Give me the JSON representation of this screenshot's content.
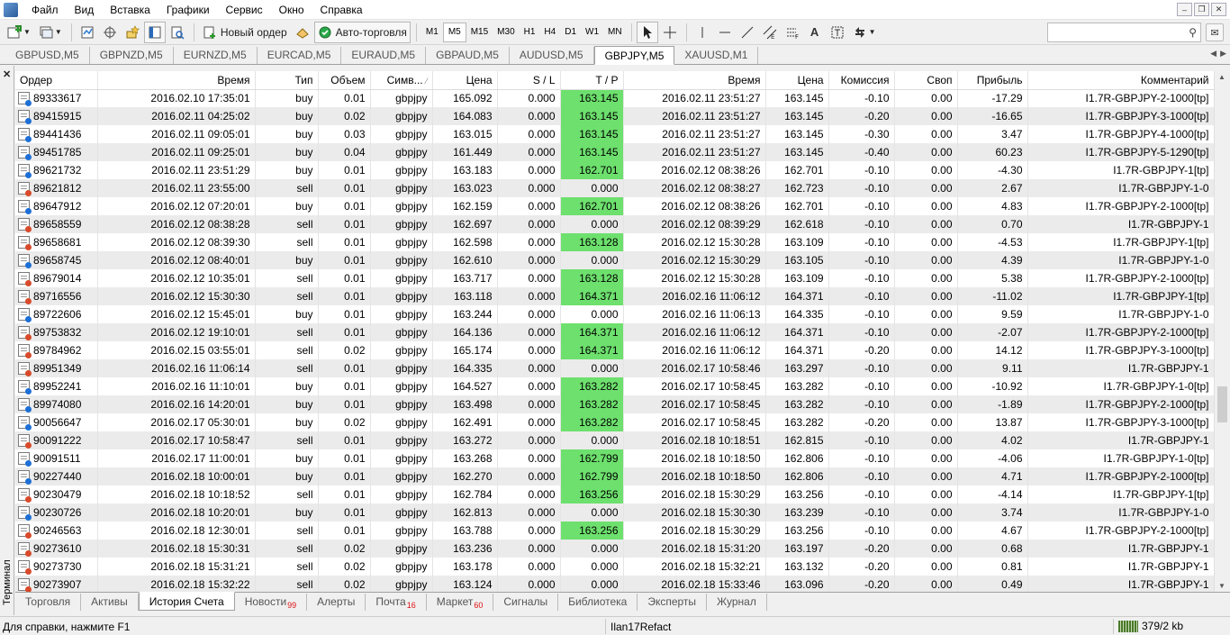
{
  "menu": {
    "items": [
      "Файл",
      "Вид",
      "Вставка",
      "Графики",
      "Сервис",
      "Окно",
      "Справка"
    ]
  },
  "toolbar": {
    "new_order_label": "Новый ордер",
    "autotrade_label": "Авто-торговля",
    "timeframes": [
      "M1",
      "M5",
      "M15",
      "M30",
      "H1",
      "H4",
      "D1",
      "W1",
      "MN"
    ],
    "active_timeframe": "M5"
  },
  "chart_tabs": [
    "GBPUSD,M5",
    "GBPNZD,M5",
    "EURNZD,M5",
    "EURCAD,M5",
    "EURAUD,M5",
    "GBPAUD,M5",
    "AUDUSD,M5",
    "GBPJPY,M5",
    "XAUUSD,M1"
  ],
  "active_chart_tab": "GBPJPY,M5",
  "terminal": {
    "label": "Терминал",
    "columns": [
      "Ордер",
      "Время",
      "Тип",
      "Объем",
      "Симв...",
      "Цена",
      "S / L",
      "T / P",
      "Время",
      "Цена",
      "Комиссия",
      "Своп",
      "Прибыль",
      "Комментарий"
    ],
    "tp_hit_color": "#6de06d",
    "rows": [
      {
        "order": "89333617",
        "open_time": "2016.02.10 17:35:01",
        "type": "buy",
        "volume": "0.01",
        "symbol": "gbpjpy",
        "open_price": "165.092",
        "sl": "0.000",
        "tp": "163.145",
        "tp_hit": true,
        "close_time": "2016.02.11 23:51:27",
        "close_price": "163.145",
        "commission": "-0.10",
        "swap": "0.00",
        "profit": "-17.29",
        "comment": "I1.7R-GBPJPY-2-1000[tp]"
      },
      {
        "order": "89415915",
        "open_time": "2016.02.11 04:25:02",
        "type": "buy",
        "volume": "0.02",
        "symbol": "gbpjpy",
        "open_price": "164.083",
        "sl": "0.000",
        "tp": "163.145",
        "tp_hit": true,
        "close_time": "2016.02.11 23:51:27",
        "close_price": "163.145",
        "commission": "-0.20",
        "swap": "0.00",
        "profit": "-16.65",
        "comment": "I1.7R-GBPJPY-3-1000[tp]"
      },
      {
        "order": "89441436",
        "open_time": "2016.02.11 09:05:01",
        "type": "buy",
        "volume": "0.03",
        "symbol": "gbpjpy",
        "open_price": "163.015",
        "sl": "0.000",
        "tp": "163.145",
        "tp_hit": true,
        "close_time": "2016.02.11 23:51:27",
        "close_price": "163.145",
        "commission": "-0.30",
        "swap": "0.00",
        "profit": "3.47",
        "comment": "I1.7R-GBPJPY-4-1000[tp]"
      },
      {
        "order": "89451785",
        "open_time": "2016.02.11 09:25:01",
        "type": "buy",
        "volume": "0.04",
        "symbol": "gbpjpy",
        "open_price": "161.449",
        "sl": "0.000",
        "tp": "163.145",
        "tp_hit": true,
        "close_time": "2016.02.11 23:51:27",
        "close_price": "163.145",
        "commission": "-0.40",
        "swap": "0.00",
        "profit": "60.23",
        "comment": "I1.7R-GBPJPY-5-1290[tp]"
      },
      {
        "order": "89621732",
        "open_time": "2016.02.11 23:51:29",
        "type": "buy",
        "volume": "0.01",
        "symbol": "gbpjpy",
        "open_price": "163.183",
        "sl": "0.000",
        "tp": "162.701",
        "tp_hit": true,
        "close_time": "2016.02.12 08:38:26",
        "close_price": "162.701",
        "commission": "-0.10",
        "swap": "0.00",
        "profit": "-4.30",
        "comment": "I1.7R-GBPJPY-1[tp]"
      },
      {
        "order": "89621812",
        "open_time": "2016.02.11 23:55:00",
        "type": "sell",
        "volume": "0.01",
        "symbol": "gbpjpy",
        "open_price": "163.023",
        "sl": "0.000",
        "tp": "0.000",
        "tp_hit": false,
        "close_time": "2016.02.12 08:38:27",
        "close_price": "162.723",
        "commission": "-0.10",
        "swap": "0.00",
        "profit": "2.67",
        "comment": "I1.7R-GBPJPY-1-0"
      },
      {
        "order": "89647912",
        "open_time": "2016.02.12 07:20:01",
        "type": "buy",
        "volume": "0.01",
        "symbol": "gbpjpy",
        "open_price": "162.159",
        "sl": "0.000",
        "tp": "162.701",
        "tp_hit": true,
        "close_time": "2016.02.12 08:38:26",
        "close_price": "162.701",
        "commission": "-0.10",
        "swap": "0.00",
        "profit": "4.83",
        "comment": "I1.7R-GBPJPY-2-1000[tp]"
      },
      {
        "order": "89658559",
        "open_time": "2016.02.12 08:38:28",
        "type": "sell",
        "volume": "0.01",
        "symbol": "gbpjpy",
        "open_price": "162.697",
        "sl": "0.000",
        "tp": "0.000",
        "tp_hit": false,
        "close_time": "2016.02.12 08:39:29",
        "close_price": "162.618",
        "commission": "-0.10",
        "swap": "0.00",
        "profit": "0.70",
        "comment": "I1.7R-GBPJPY-1"
      },
      {
        "order": "89658681",
        "open_time": "2016.02.12 08:39:30",
        "type": "sell",
        "volume": "0.01",
        "symbol": "gbpjpy",
        "open_price": "162.598",
        "sl": "0.000",
        "tp": "163.128",
        "tp_hit": true,
        "close_time": "2016.02.12 15:30:28",
        "close_price": "163.109",
        "commission": "-0.10",
        "swap": "0.00",
        "profit": "-4.53",
        "comment": "I1.7R-GBPJPY-1[tp]"
      },
      {
        "order": "89658745",
        "open_time": "2016.02.12 08:40:01",
        "type": "buy",
        "volume": "0.01",
        "symbol": "gbpjpy",
        "open_price": "162.610",
        "sl": "0.000",
        "tp": "0.000",
        "tp_hit": false,
        "close_time": "2016.02.12 15:30:29",
        "close_price": "163.105",
        "commission": "-0.10",
        "swap": "0.00",
        "profit": "4.39",
        "comment": "I1.7R-GBPJPY-1-0"
      },
      {
        "order": "89679014",
        "open_time": "2016.02.12 10:35:01",
        "type": "sell",
        "volume": "0.01",
        "symbol": "gbpjpy",
        "open_price": "163.717",
        "sl": "0.000",
        "tp": "163.128",
        "tp_hit": true,
        "close_time": "2016.02.12 15:30:28",
        "close_price": "163.109",
        "commission": "-0.10",
        "swap": "0.00",
        "profit": "5.38",
        "comment": "I1.7R-GBPJPY-2-1000[tp]"
      },
      {
        "order": "89716556",
        "open_time": "2016.02.12 15:30:30",
        "type": "sell",
        "volume": "0.01",
        "symbol": "gbpjpy",
        "open_price": "163.118",
        "sl": "0.000",
        "tp": "164.371",
        "tp_hit": true,
        "close_time": "2016.02.16 11:06:12",
        "close_price": "164.371",
        "commission": "-0.10",
        "swap": "0.00",
        "profit": "-11.02",
        "comment": "I1.7R-GBPJPY-1[tp]"
      },
      {
        "order": "89722606",
        "open_time": "2016.02.12 15:45:01",
        "type": "buy",
        "volume": "0.01",
        "symbol": "gbpjpy",
        "open_price": "163.244",
        "sl": "0.000",
        "tp": "0.000",
        "tp_hit": false,
        "close_time": "2016.02.16 11:06:13",
        "close_price": "164.335",
        "commission": "-0.10",
        "swap": "0.00",
        "profit": "9.59",
        "comment": "I1.7R-GBPJPY-1-0"
      },
      {
        "order": "89753832",
        "open_time": "2016.02.12 19:10:01",
        "type": "sell",
        "volume": "0.01",
        "symbol": "gbpjpy",
        "open_price": "164.136",
        "sl": "0.000",
        "tp": "164.371",
        "tp_hit": true,
        "close_time": "2016.02.16 11:06:12",
        "close_price": "164.371",
        "commission": "-0.10",
        "swap": "0.00",
        "profit": "-2.07",
        "comment": "I1.7R-GBPJPY-2-1000[tp]"
      },
      {
        "order": "89784962",
        "open_time": "2016.02.15 03:55:01",
        "type": "sell",
        "volume": "0.02",
        "symbol": "gbpjpy",
        "open_price": "165.174",
        "sl": "0.000",
        "tp": "164.371",
        "tp_hit": true,
        "close_time": "2016.02.16 11:06:12",
        "close_price": "164.371",
        "commission": "-0.20",
        "swap": "0.00",
        "profit": "14.12",
        "comment": "I1.7R-GBPJPY-3-1000[tp]"
      },
      {
        "order": "89951349",
        "open_time": "2016.02.16 11:06:14",
        "type": "sell",
        "volume": "0.01",
        "symbol": "gbpjpy",
        "open_price": "164.335",
        "sl": "0.000",
        "tp": "0.000",
        "tp_hit": false,
        "close_time": "2016.02.17 10:58:46",
        "close_price": "163.297",
        "commission": "-0.10",
        "swap": "0.00",
        "profit": "9.11",
        "comment": "I1.7R-GBPJPY-1"
      },
      {
        "order": "89952241",
        "open_time": "2016.02.16 11:10:01",
        "type": "buy",
        "volume": "0.01",
        "symbol": "gbpjpy",
        "open_price": "164.527",
        "sl": "0.000",
        "tp": "163.282",
        "tp_hit": true,
        "close_time": "2016.02.17 10:58:45",
        "close_price": "163.282",
        "commission": "-0.10",
        "swap": "0.00",
        "profit": "-10.92",
        "comment": "I1.7R-GBPJPY-1-0[tp]"
      },
      {
        "order": "89974080",
        "open_time": "2016.02.16 14:20:01",
        "type": "buy",
        "volume": "0.01",
        "symbol": "gbpjpy",
        "open_price": "163.498",
        "sl": "0.000",
        "tp": "163.282",
        "tp_hit": true,
        "close_time": "2016.02.17 10:58:45",
        "close_price": "163.282",
        "commission": "-0.10",
        "swap": "0.00",
        "profit": "-1.89",
        "comment": "I1.7R-GBPJPY-2-1000[tp]"
      },
      {
        "order": "90056647",
        "open_time": "2016.02.17 05:30:01",
        "type": "buy",
        "volume": "0.02",
        "symbol": "gbpjpy",
        "open_price": "162.491",
        "sl": "0.000",
        "tp": "163.282",
        "tp_hit": true,
        "close_time": "2016.02.17 10:58:45",
        "close_price": "163.282",
        "commission": "-0.20",
        "swap": "0.00",
        "profit": "13.87",
        "comment": "I1.7R-GBPJPY-3-1000[tp]"
      },
      {
        "order": "90091222",
        "open_time": "2016.02.17 10:58:47",
        "type": "sell",
        "volume": "0.01",
        "symbol": "gbpjpy",
        "open_price": "163.272",
        "sl": "0.000",
        "tp": "0.000",
        "tp_hit": false,
        "close_time": "2016.02.18 10:18:51",
        "close_price": "162.815",
        "commission": "-0.10",
        "swap": "0.00",
        "profit": "4.02",
        "comment": "I1.7R-GBPJPY-1"
      },
      {
        "order": "90091511",
        "open_time": "2016.02.17 11:00:01",
        "type": "buy",
        "volume": "0.01",
        "symbol": "gbpjpy",
        "open_price": "163.268",
        "sl": "0.000",
        "tp": "162.799",
        "tp_hit": true,
        "close_time": "2016.02.18 10:18:50",
        "close_price": "162.806",
        "commission": "-0.10",
        "swap": "0.00",
        "profit": "-4.06",
        "comment": "I1.7R-GBPJPY-1-0[tp]"
      },
      {
        "order": "90227440",
        "open_time": "2016.02.18 10:00:01",
        "type": "buy",
        "volume": "0.01",
        "symbol": "gbpjpy",
        "open_price": "162.270",
        "sl": "0.000",
        "tp": "162.799",
        "tp_hit": true,
        "close_time": "2016.02.18 10:18:50",
        "close_price": "162.806",
        "commission": "-0.10",
        "swap": "0.00",
        "profit": "4.71",
        "comment": "I1.7R-GBPJPY-2-1000[tp]"
      },
      {
        "order": "90230479",
        "open_time": "2016.02.18 10:18:52",
        "type": "sell",
        "volume": "0.01",
        "symbol": "gbpjpy",
        "open_price": "162.784",
        "sl": "0.000",
        "tp": "163.256",
        "tp_hit": true,
        "close_time": "2016.02.18 15:30:29",
        "close_price": "163.256",
        "commission": "-0.10",
        "swap": "0.00",
        "profit": "-4.14",
        "comment": "I1.7R-GBPJPY-1[tp]"
      },
      {
        "order": "90230726",
        "open_time": "2016.02.18 10:20:01",
        "type": "buy",
        "volume": "0.01",
        "symbol": "gbpjpy",
        "open_price": "162.813",
        "sl": "0.000",
        "tp": "0.000",
        "tp_hit": false,
        "close_time": "2016.02.18 15:30:30",
        "close_price": "163.239",
        "commission": "-0.10",
        "swap": "0.00",
        "profit": "3.74",
        "comment": "I1.7R-GBPJPY-1-0"
      },
      {
        "order": "90246563",
        "open_time": "2016.02.18 12:30:01",
        "type": "sell",
        "volume": "0.01",
        "symbol": "gbpjpy",
        "open_price": "163.788",
        "sl": "0.000",
        "tp": "163.256",
        "tp_hit": true,
        "close_time": "2016.02.18 15:30:29",
        "close_price": "163.256",
        "commission": "-0.10",
        "swap": "0.00",
        "profit": "4.67",
        "comment": "I1.7R-GBPJPY-2-1000[tp]"
      },
      {
        "order": "90273610",
        "open_time": "2016.02.18 15:30:31",
        "type": "sell",
        "volume": "0.02",
        "symbol": "gbpjpy",
        "open_price": "163.236",
        "sl": "0.000",
        "tp": "0.000",
        "tp_hit": false,
        "close_time": "2016.02.18 15:31:20",
        "close_price": "163.197",
        "commission": "-0.20",
        "swap": "0.00",
        "profit": "0.68",
        "comment": "I1.7R-GBPJPY-1"
      },
      {
        "order": "90273730",
        "open_time": "2016.02.18 15:31:21",
        "type": "sell",
        "volume": "0.02",
        "symbol": "gbpjpy",
        "open_price": "163.178",
        "sl": "0.000",
        "tp": "0.000",
        "tp_hit": false,
        "close_time": "2016.02.18 15:32:21",
        "close_price": "163.132",
        "commission": "-0.20",
        "swap": "0.00",
        "profit": "0.81",
        "comment": "I1.7R-GBPJPY-1"
      },
      {
        "order": "90273907",
        "open_time": "2016.02.18 15:32:22",
        "type": "sell",
        "volume": "0.02",
        "symbol": "gbpjpy",
        "open_price": "163.124",
        "sl": "0.000",
        "tp": "0.000",
        "tp_hit": false,
        "close_time": "2016.02.18 15:33:46",
        "close_price": "163.096",
        "commission": "-0.20",
        "swap": "0.00",
        "profit": "0.49",
        "comment": "I1.7R-GBPJPY-1"
      }
    ]
  },
  "bottom_tabs": [
    {
      "label": "Торговля",
      "count": ""
    },
    {
      "label": "Активы",
      "count": ""
    },
    {
      "label": "История Счета",
      "count": ""
    },
    {
      "label": "Новости",
      "count": "99"
    },
    {
      "label": "Алерты",
      "count": ""
    },
    {
      "label": "Почта",
      "count": "16"
    },
    {
      "label": "Маркет",
      "count": "60"
    },
    {
      "label": "Сигналы",
      "count": ""
    },
    {
      "label": "Библиотека",
      "count": ""
    },
    {
      "label": "Эксперты",
      "count": ""
    },
    {
      "label": "Журнал",
      "count": ""
    }
  ],
  "active_bottom_tab": "История Счета",
  "statusbar": {
    "help_text": "Для справки, нажмите F1",
    "profile": "Ilan17Refact",
    "traffic": "379/2 kb"
  },
  "icons": {
    "order_buy_dot": "#1d6fd6",
    "order_sell_dot": "#d84a2a"
  }
}
